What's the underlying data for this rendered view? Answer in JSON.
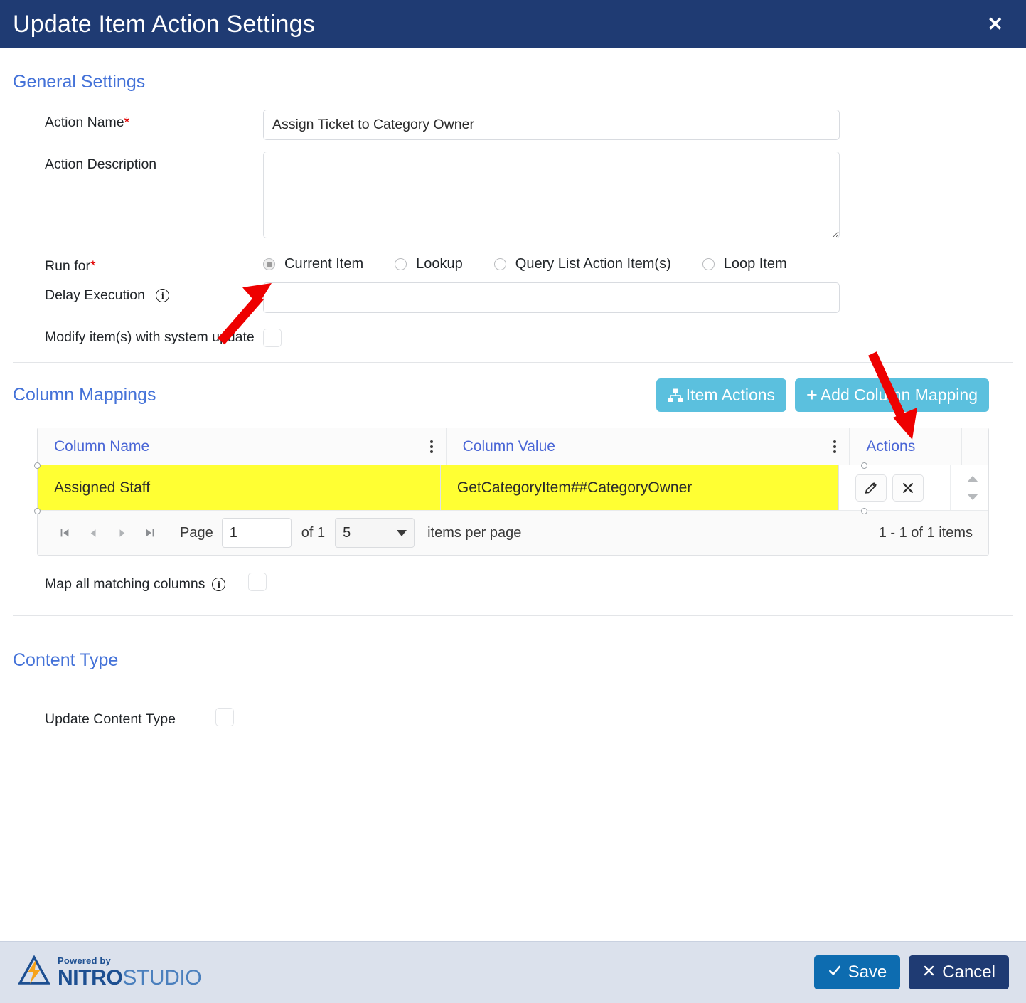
{
  "window": {
    "title": "Update Item Action Settings",
    "close_label": "✕"
  },
  "sections": {
    "general": "General Settings",
    "column_mappings": "Column Mappings",
    "content_type": "Content Type"
  },
  "general": {
    "action_name_label": "Action Name",
    "action_name_required": "*",
    "action_name_value": "Assign Ticket to Category Owner",
    "action_description_label": "Action Description",
    "action_description_value": "",
    "run_for_label": "Run for",
    "run_for_required": "*",
    "run_for_options": [
      {
        "label": "Current Item",
        "checked": true
      },
      {
        "label": "Lookup",
        "checked": false
      },
      {
        "label": "Query List Action Item(s)",
        "checked": false
      },
      {
        "label": "Loop Item",
        "checked": false
      }
    ],
    "delay_execution_label": "Delay Execution",
    "delay_execution_info": "i",
    "delay_execution_value": "",
    "modify_system_update_label": "Modify item(s) with system update",
    "modify_system_update_checked": false
  },
  "column_mappings": {
    "item_actions_button": "Item Actions",
    "add_column_mapping_button": "Add Column Mapping",
    "add_prefix": "+",
    "columns": [
      "Column Name",
      "Column Value",
      "Actions"
    ],
    "rows": [
      {
        "column_name": "Assigned Staff",
        "column_value": "GetCategoryItem##CategoryOwner",
        "highlighted": true
      }
    ],
    "row_actions": {
      "edit": "edit-icon",
      "delete": "delete-icon"
    },
    "pager": {
      "first": "⏮",
      "prev": "◀",
      "next": "▶",
      "last": "⏭",
      "page_label": "Page",
      "page_value": "1",
      "of_label": "of 1",
      "page_size": "5",
      "items_per_page_label": "items per page",
      "range_label": "1 - 1 of 1 items"
    },
    "map_all_label": "Map all matching columns",
    "map_all_info": "i",
    "map_all_checked": false
  },
  "content_type": {
    "update_content_type_label": "Update Content Type",
    "update_content_type_checked": false
  },
  "footer": {
    "logo_powered": "Powered by",
    "logo_nitro": "NITRO",
    "logo_studio": "STUDIO",
    "save_label": "Save",
    "cancel_label": "Cancel"
  },
  "colors": {
    "header_bg": "#1f3b73",
    "accent_link": "#4472d8",
    "button_light_blue": "#5bc0de",
    "save_blue": "#0d6cb0",
    "cancel_navy": "#1f3b73",
    "highlight_yellow": "#ffff33",
    "annotation_red": "#ee0000",
    "footer_bg": "#dbe1ec",
    "required_red": "#e00000"
  },
  "annotations": [
    {
      "name": "arrow-to-current-item-radio",
      "color": "#ee0000"
    },
    {
      "name": "arrow-to-add-column-mapping",
      "color": "#ee0000"
    }
  ]
}
